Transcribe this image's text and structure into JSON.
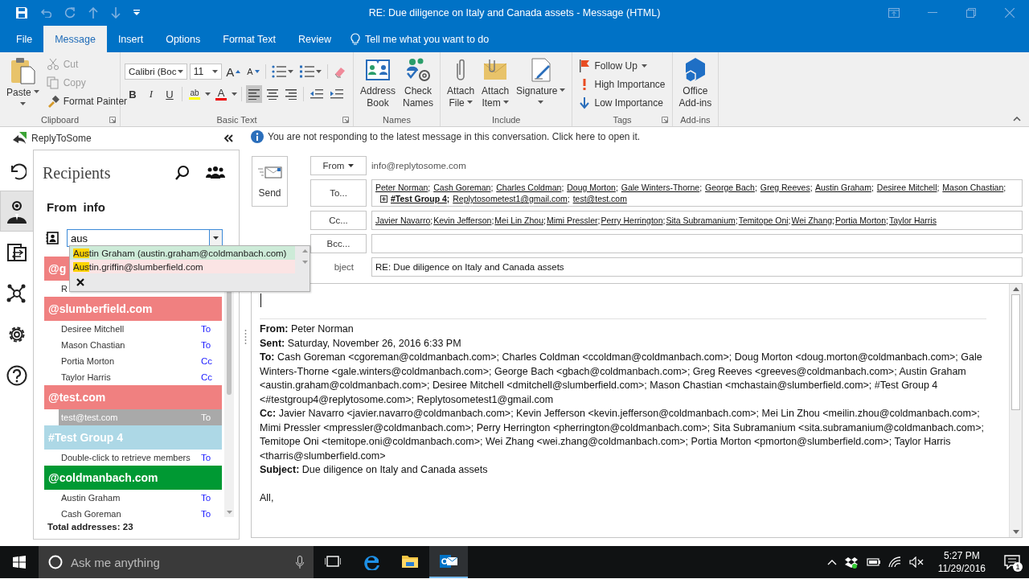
{
  "window": {
    "title": "RE: Due diligence on Italy and Canada assets - Message (HTML)"
  },
  "tabs": [
    {
      "label": "File",
      "selected": false
    },
    {
      "label": "Message",
      "selected": true
    },
    {
      "label": "Insert",
      "selected": false
    },
    {
      "label": "Options",
      "selected": false
    },
    {
      "label": "Format Text",
      "selected": false
    },
    {
      "label": "Review",
      "selected": false
    }
  ],
  "tell_me": "Tell me what you want to do",
  "ribbon": {
    "clipboard": {
      "label": "Clipboard",
      "paste": "Paste",
      "cut": {
        "label": "Cut",
        "disabled": true
      },
      "copy": {
        "label": "Copy",
        "disabled": true
      },
      "format_painter": {
        "label": "Format Painter",
        "disabled": false
      }
    },
    "basic_text": {
      "label": "Basic Text",
      "font": "Calibri (Boc",
      "size": "11",
      "grow": "A",
      "shrink": "A",
      "bold": "B",
      "italic": "I",
      "underline": "U",
      "highlight": "ab",
      "font_color": "A",
      "alignment": [
        {
          "selected": true
        },
        {
          "selected": false
        },
        {
          "selected": false
        }
      ]
    },
    "names": {
      "label": "Names",
      "address_book": [
        "Address",
        "Book"
      ],
      "check_names": [
        "Check",
        "Names"
      ]
    },
    "include": {
      "label": "Include",
      "attach_file": [
        "Attach",
        "File"
      ],
      "attach_item": [
        "Attach",
        "Item"
      ],
      "signature": [
        "Signature"
      ]
    },
    "tags": {
      "label": "Tags",
      "follow_up": "Follow Up",
      "high": "High Importance",
      "low": "Low Importance"
    },
    "addins": {
      "label": "Add-ins",
      "office_addins": [
        "Office",
        "Add-ins"
      ]
    }
  },
  "addin": {
    "title": "ReplyToSome"
  },
  "side_nav": [
    {
      "selected": false
    },
    {
      "selected": true
    },
    {
      "selected": false
    },
    {
      "selected": false
    },
    {
      "selected": false
    },
    {
      "selected": false
    }
  ],
  "recipients_panel": {
    "title": "Recipients",
    "from_label": "From",
    "from_value": "info",
    "search": {
      "value": "aus"
    },
    "suggestions": [
      {
        "match": "Aus",
        "rest": "tin Graham (austin.graham@coldmanbach.com)",
        "color": "#cdebd8"
      },
      {
        "match": "Aus",
        "rest": "tin.griffin@slumberfield.com",
        "color": "#fbe4e4"
      }
    ],
    "groups": [
      {
        "name": "@g",
        "color": "#f08080",
        "members": [
          {
            "name": "R",
            "selected": false
          }
        ]
      },
      {
        "name": "@slumberfield.com",
        "color": "#f08080",
        "members": [
          {
            "name": "Desiree Mitchell",
            "type": "To",
            "selected": false
          },
          {
            "name": "Mason Chastian",
            "type": "To",
            "selected": false
          },
          {
            "name": "Portia Morton",
            "type": "Cc",
            "selected": false
          },
          {
            "name": "Taylor Harris",
            "type": "Cc",
            "selected": false
          }
        ]
      },
      {
        "name": "@test.com",
        "color": "#f08080",
        "members": [
          {
            "name": "test@test.com",
            "type": "To",
            "selected": true
          }
        ]
      },
      {
        "name": "#Test Group 4",
        "color": "#add8e6",
        "members": [
          {
            "name": "Double-click to retrieve members",
            "type": "To",
            "selected": false
          }
        ]
      },
      {
        "name": "@coldmanbach.com",
        "color": "#009933",
        "members": [
          {
            "name": "Austin Graham",
            "type": "To",
            "selected": false
          },
          {
            "name": "Cash Goreman",
            "type": "To",
            "selected": false
          }
        ]
      }
    ],
    "total": "Total addresses: 23"
  },
  "info_bar": "You are not responding to the latest message in this conversation. Click here to open it.",
  "compose": {
    "send": "Send",
    "from_button": "From",
    "from_value": "info@replytosome.com",
    "to_button": "To...",
    "to": [
      {
        "name": "Peter Norman",
        "separator": ";",
        "kind": "contact"
      },
      {
        "name": "Cash Goreman",
        "separator": ";",
        "kind": "contact"
      },
      {
        "name": "Charles Coldman",
        "separator": ";",
        "kind": "contact"
      },
      {
        "name": "Doug Morton",
        "separator": ";",
        "kind": "contact"
      },
      {
        "name": "Gale Winters-Thorne",
        "separator": ";",
        "kind": "contact"
      },
      {
        "name": "George Bach",
        "separator": ";",
        "kind": "contact"
      },
      {
        "name": "Greg Reeves",
        "separator": ";",
        "kind": "contact"
      },
      {
        "name": "Austin Graham",
        "separator": ";",
        "kind": "contact"
      },
      {
        "name": "Desiree Mitchell",
        "separator": ";",
        "kind": "contact"
      },
      {
        "name": "Mason Chastian",
        "separator": ";",
        "kind": "contact"
      },
      {
        "name": "#Test Group 4",
        "separator": ";",
        "kind": "group"
      },
      {
        "name": "Replytosometest1@gmail.com",
        "separator": ";",
        "kind": "contact"
      },
      {
        "name": "test@test.com",
        "kind": "contact"
      }
    ],
    "cc_button": "Cc...",
    "cc": [
      {
        "name": "Javier Navarro",
        "separator": ";",
        "kind": "contact"
      },
      {
        "name": "Kevin Jefferson",
        "separator": ";",
        "kind": "contact"
      },
      {
        "name": "Mei Lin Zhou",
        "separator": ";",
        "kind": "contact"
      },
      {
        "name": "Mimi Pressler",
        "separator": ";",
        "kind": "contact"
      },
      {
        "name": "Perry Herrington",
        "separator": ";",
        "kind": "contact"
      },
      {
        "name": "Sita Subramanium",
        "separator": ";",
        "kind": "contact"
      },
      {
        "name": "Temitope Oni",
        "separator": ";",
        "kind": "contact"
      },
      {
        "name": "Wei Zhang",
        "separator": ";",
        "kind": "contact"
      },
      {
        "name": "Portia Morton",
        "separator": ";",
        "kind": "contact"
      },
      {
        "name": "Taylor Harris",
        "kind": "contact"
      }
    ],
    "bcc_button": "Bcc...",
    "subject_label": "bject",
    "subject": "RE: Due diligence on Italy and Canada assets"
  },
  "body": {
    "header": [
      "**From:** Peter Norman",
      "**Sent:** Saturday, November 26, 2016 6:33 PM",
      "**To:** Cash Goreman <cgoreman@coldmanbach.com>; Charles Coldman <ccoldman@coldmanbach.com>; Doug Morton <doug.morton@coldmanbach.com>; Gale Winters-Thorne <gale.winters@coldmanbach.com>; George Bach <gbach@coldmanbach.com>; Greg Reeves <greeves@coldmanbach.com>; Austin Graham <austin.graham@coldmanbach.com>; Desiree Mitchell <dmitchell@slumberfield.com>; Mason Chastian <mchastain@slumberfield.com>; #Test Group 4 <#testgroup4@replytosome.com>; Replytosometest1@gmail.com",
      "**Cc:** Javier Navarro <javier.navarro@coldmanbach.com>; Kevin Jefferson <kevin.jefferson@coldmanbach.com>; Mei Lin Zhou <meilin.zhou@coldmanbach.com>; Mimi Pressler <mpressler@coldmanbach.com>; Perry Herrington <pherrington@coldmanbach.com>; Sita Subramanium <sita.subramanium@coldmanbach.com>; Temitope Oni <temitope.oni@coldmanbach.com>; Wei Zhang <wei.zhang@coldmanbach.com>; Portia Morton <pmorton@slumberfield.com>; Taylor Harris <tharris@slumberfield.com>",
      "**Subject:** Due diligence on Italy and Canada assets"
    ],
    "greeting": "All,"
  },
  "taskbar": {
    "search_placeholder": "Ask me anything",
    "apps": [
      {
        "selected": false
      },
      {
        "selected": false
      },
      {
        "selected": false
      },
      {
        "selected": true
      }
    ],
    "time": "5:27 PM",
    "date": "11/29/2016",
    "notifications": "1"
  }
}
